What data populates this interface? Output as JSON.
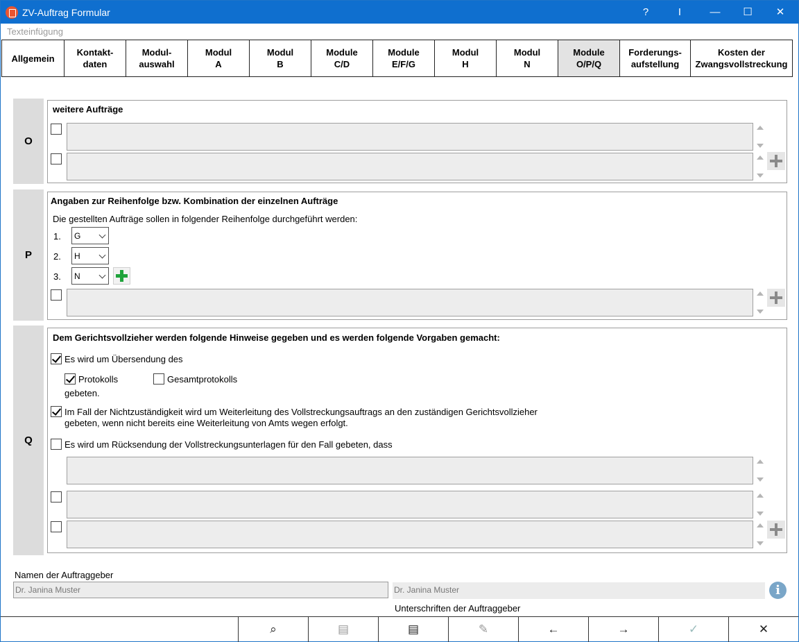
{
  "window": {
    "title": "ZV-Auftrag Formular",
    "help": "?",
    "cursor": "I",
    "minimize": "—",
    "maximize": "☐",
    "close": "✕"
  },
  "textfuegung": "Texteinfügung",
  "tabs": [
    {
      "label": "Allgemein"
    },
    {
      "label": "Kontakt-\ndaten"
    },
    {
      "label": "Modul-\nauswahl"
    },
    {
      "label": "Modul\nA"
    },
    {
      "label": "Modul\nB"
    },
    {
      "label": "Module\nC/D"
    },
    {
      "label": "Module\nE/F/G"
    },
    {
      "label": "Modul\nH"
    },
    {
      "label": "Modul\nN"
    },
    {
      "label": "Module\nO/P/Q",
      "active": true
    },
    {
      "label": "Forderungs-\naufstellung"
    },
    {
      "label": "Kosten der\nZwangsvollstreckung"
    }
  ],
  "sectionO": {
    "label": "O",
    "title": "weitere Aufträge"
  },
  "sectionP": {
    "label": "P",
    "title": "Angaben zur Reihenfolge bzw. Kombination der einzelnen Aufträge",
    "intro": "Die gestellten Aufträge sollen in folgender Reihenfolge durchgeführt werden:",
    "orders": [
      {
        "num": "1.",
        "value": "G"
      },
      {
        "num": "2.",
        "value": "H"
      },
      {
        "num": "3.",
        "value": "N"
      }
    ]
  },
  "sectionQ": {
    "label": "Q",
    "title": "Dem Gerichtsvollzieher werden folgende Hinweise gegeben und es werden folgende Vorgaben gemacht:",
    "uebersendung": "Es wird um Übersendung des",
    "protokolls": "Protokolls",
    "gesamtprotokolls": "Gesamtprotokolls",
    "gebeten": "gebeten.",
    "weiterleitung_1": "Im Fall der Nichtzuständigkeit wird um Weiterleitung des Vollstreckungsauftrags an den zuständigen Gerichtsvollzieher",
    "weiterleitung_2": "gebeten, wenn nicht bereits eine Weiterleitung von Amts wegen erfolgt.",
    "ruecksendung": "Es wird um Rücksendung der Vollstreckungsunterlagen für den Fall gebeten, dass"
  },
  "footer": {
    "names_label": "Namen der Auftraggeber",
    "name_value": "Dr. Janina Muster",
    "signature_value": "Dr. Janina Muster",
    "signatures_label": "Unterschriften der Auftraggeber",
    "info": "i"
  },
  "toolbar": {
    "search": "⌕",
    "clip1": "▤",
    "clip2": "▤",
    "edit": "✎",
    "back": "←",
    "forward": "→",
    "ok": "✓",
    "cancel": "✕"
  }
}
